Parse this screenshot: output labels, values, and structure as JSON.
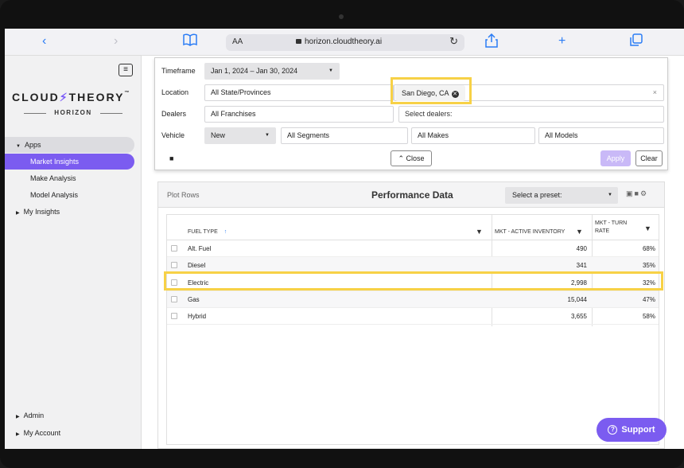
{
  "browser": {
    "text_size_label": "AA",
    "url": "horizon.cloudtheory.ai",
    "back_icon": "chevron-left-icon",
    "forward_icon": "chevron-right-icon",
    "bookmarks_icon": "book-icon",
    "reload_icon": "reload-icon",
    "share_icon": "share-icon",
    "new_tab_icon": "plus-icon",
    "tabs_icon": "tabs-icon"
  },
  "sidebar": {
    "logo_left": "CLOUD",
    "logo_right": "THEORY",
    "logo_tm": "™",
    "logo_sub": "HORIZON",
    "apps_label": "Apps",
    "items": [
      {
        "label": "Market Insights"
      },
      {
        "label": "Make Analysis"
      },
      {
        "label": "Model Analysis"
      }
    ],
    "my_insights_label": "My Insights",
    "admin_label": "Admin",
    "my_account_label": "My Account"
  },
  "filters": {
    "timeframe_label": "Timeframe",
    "timeframe_value": "Jan 1, 2024 – Jan 30, 2024",
    "location_label": "Location",
    "location_scope": "All State/Provinces",
    "location_chip": "San Diego, CA",
    "dealers_label": "Dealers",
    "dealers_scope": "All Franchises",
    "dealers_placeholder": "Select dealers:",
    "vehicle_label": "Vehicle",
    "vehicle_condition": "New",
    "vehicle_segments": "All Segments",
    "vehicle_makes": "All Makes",
    "vehicle_models": "All Models",
    "close_label": "Close",
    "apply_label": "Apply",
    "clear_label": "Clear"
  },
  "performance": {
    "plot_rows_label": "Plot Rows",
    "title": "Performance Data",
    "preset_label": "Select a preset:",
    "columns": [
      "FUEL TYPE",
      "MKT - ACTIVE INVENTORY",
      "MKT - TURN",
      "RATE"
    ],
    "rows": [
      {
        "fuel": "Alt. Fuel",
        "inventory": "490",
        "turn": "68%"
      },
      {
        "fuel": "Diesel",
        "inventory": "341",
        "turn": "35%"
      },
      {
        "fuel": "Electric",
        "inventory": "2,998",
        "turn": "32%"
      },
      {
        "fuel": "Gas",
        "inventory": "15,044",
        "turn": "47%"
      },
      {
        "fuel": "Hybrid",
        "inventory": "3,655",
        "turn": "58%"
      }
    ]
  },
  "support_label": "Support",
  "colors": {
    "accent": "#7b5cf0",
    "highlight": "#f7d146"
  }
}
